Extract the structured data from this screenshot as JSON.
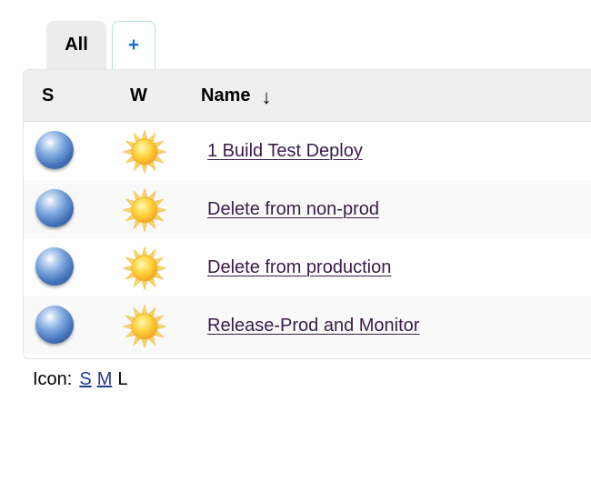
{
  "tabs": [
    {
      "label": "All",
      "active": true
    },
    {
      "label": "+",
      "active": false
    }
  ],
  "table": {
    "headers": {
      "status": "S",
      "weather": "W",
      "name": "Name",
      "sort_indicator": "↓"
    },
    "rows": [
      {
        "status_icon": "blue-ball-icon",
        "weather_icon": "sunny-icon",
        "name": "1 Build Test Deploy"
      },
      {
        "status_icon": "blue-ball-icon",
        "weather_icon": "sunny-icon",
        "name": "Delete from non-prod"
      },
      {
        "status_icon": "blue-ball-icon",
        "weather_icon": "sunny-icon",
        "name": "Delete from production"
      },
      {
        "status_icon": "blue-ball-icon",
        "weather_icon": "sunny-icon",
        "name": "Release-Prod and Monitor"
      }
    ]
  },
  "icon_size": {
    "label": "Icon:",
    "options": [
      "S",
      "M",
      "L"
    ],
    "current": "L"
  },
  "colors": {
    "link": "#3b1b48",
    "add_tab": "#1b74d4",
    "header_bg": "#efefef"
  }
}
